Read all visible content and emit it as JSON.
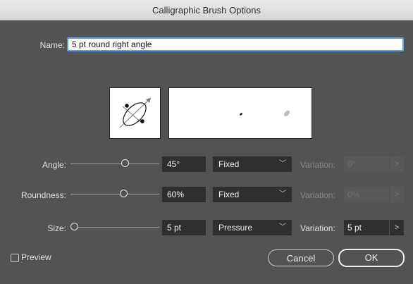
{
  "dialog": {
    "title": "Calligraphic Brush Options"
  },
  "name": {
    "label": "Name:",
    "value": "5 pt round right angle"
  },
  "rows": {
    "angle": {
      "label": "Angle:",
      "value": "45°",
      "mode": "Fixed",
      "variation_label": "Variation:",
      "variation_value": "0°",
      "variation_enabled": false,
      "slider_position": 0.59
    },
    "roundness": {
      "label": "Roundness:",
      "value": "60%",
      "mode": "Fixed",
      "variation_label": "Variation:",
      "variation_value": "0%",
      "variation_enabled": false,
      "slider_position": 0.59
    },
    "size": {
      "label": "Size:",
      "value": "5 pt",
      "mode": "Pressure",
      "variation_label": "Variation:",
      "variation_value": "5 pt",
      "variation_enabled": true,
      "slider_position": 0.0
    }
  },
  "preview": {
    "label": "Preview",
    "checked": false
  },
  "buttons": {
    "cancel": "Cancel",
    "ok": "OK"
  },
  "icons": {
    "dropdown": "chevron-down-icon",
    "stepper": "chevron-right-icon",
    "brush_angle": "brush-angle-ellipse-icon"
  },
  "colors": {
    "focus_ring": "#5aa0e8",
    "dialog_bg": "#535353",
    "field_bg": "#2f2f2f"
  }
}
